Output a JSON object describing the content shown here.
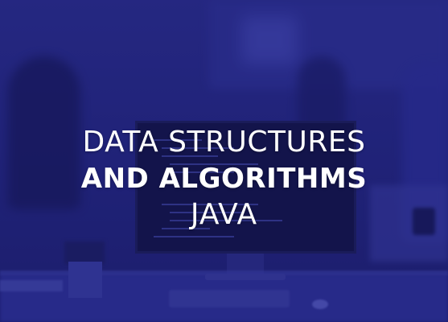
{
  "title": {
    "line1": "DATA STRUCTURES",
    "line2": "AND ALGORITHMS",
    "line3": "JAVA"
  },
  "colors": {
    "tint": "#23257a",
    "text": "#ffffff"
  },
  "scene_elements": [
    "office-background",
    "monitor",
    "keyboard",
    "mouse",
    "pen-cup",
    "people"
  ]
}
